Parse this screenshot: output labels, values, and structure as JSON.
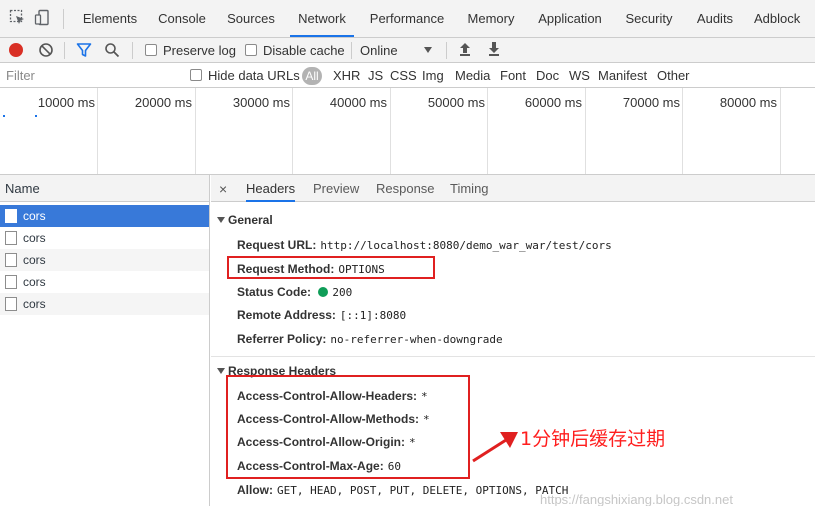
{
  "tabs": [
    {
      "label": "Elements"
    },
    {
      "label": "Console"
    },
    {
      "label": "Sources"
    },
    {
      "label": "Network"
    },
    {
      "label": "Performance"
    },
    {
      "label": "Memory"
    },
    {
      "label": "Application"
    },
    {
      "label": "Security"
    },
    {
      "label": "Audits"
    },
    {
      "label": "Adblock"
    }
  ],
  "active_tab": "Network",
  "toolbar": {
    "preserve_log": "Preserve log",
    "disable_cache": "Disable cache",
    "throttle": "Online"
  },
  "filter": {
    "placeholder": "Filter",
    "hide_data_urls": "Hide data URLs",
    "all": "All",
    "types": [
      "XHR",
      "JS",
      "CSS",
      "Img",
      "Media",
      "Font",
      "Doc",
      "WS",
      "Manifest",
      "Other"
    ]
  },
  "timeline": {
    "ticks": [
      "10000 ms",
      "20000 ms",
      "30000 ms",
      "40000 ms",
      "50000 ms",
      "60000 ms",
      "70000 ms",
      "80000 ms"
    ]
  },
  "requests": {
    "header": "Name",
    "rows": [
      "cors",
      "cors",
      "cors",
      "cors",
      "cors"
    ]
  },
  "details": {
    "tabs": [
      "Headers",
      "Preview",
      "Response",
      "Timing"
    ],
    "general_title": "General",
    "general": [
      {
        "key": "Request URL:",
        "value": "http://localhost:8080/demo_war_war/test/cors"
      },
      {
        "key": "Request Method:",
        "value": "OPTIONS"
      },
      {
        "key": "Status Code:",
        "value": "200"
      },
      {
        "key": "Remote Address:",
        "value": "[::1]:8080"
      },
      {
        "key": "Referrer Policy:",
        "value": "no-referrer-when-downgrade"
      }
    ],
    "response_title": "Response Headers",
    "response": [
      {
        "key": "Access-Control-Allow-Headers:",
        "value": "*"
      },
      {
        "key": "Access-Control-Allow-Methods:",
        "value": "*"
      },
      {
        "key": "Access-Control-Allow-Origin:",
        "value": "*"
      },
      {
        "key": "Access-Control-Max-Age:",
        "value": "60"
      },
      {
        "key": "Allow:",
        "value": "GET, HEAD, POST, PUT, DELETE, OPTIONS, PATCH"
      }
    ]
  },
  "annotation": "1分钟后缓存过期",
  "watermark": "https://fangshixiang.blog.csdn.net",
  "colors": {
    "annotation_red": "#e02020",
    "status_green": "#0f9d58",
    "selected_row": "#3879d9",
    "record_red": "#d93025",
    "filter_blue": "#1a73e8"
  }
}
